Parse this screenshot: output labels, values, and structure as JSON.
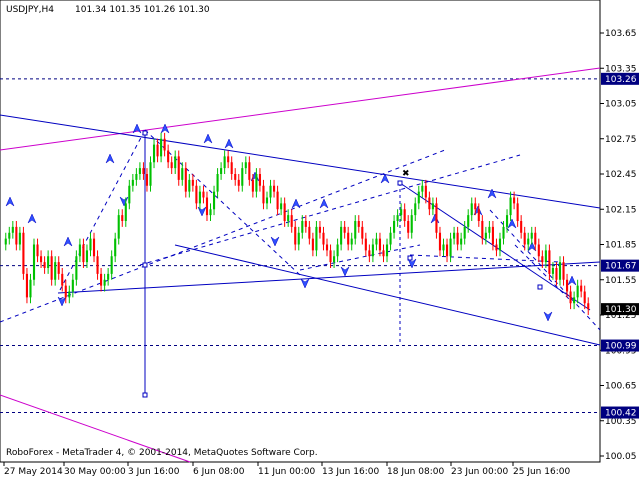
{
  "header": {
    "symbol": "USDJPY,H4",
    "ohlc": "101.34 101.35 101.26 101.30"
  },
  "footer": {
    "copyright": "RoboForex - MetaTrader 4, © 2001-2014, MetaQuotes Software Corp."
  },
  "chart_data": {
    "type": "candlestick",
    "title": "USDJPY,H4",
    "ylim": [
      99.975,
      103.775
    ],
    "y_ticks": [
      "103.65",
      "103.35",
      "103.05",
      "102.75",
      "102.45",
      "102.15",
      "101.85",
      "101.55",
      "101.25",
      "100.95",
      "100.65",
      "100.35",
      "100.05"
    ],
    "x_ticks": [
      "27 May 2014",
      "30 May 00:00",
      "3 Jun 16:00",
      "6 Jun 08:00",
      "11 Jun 00:00",
      "13 Jun 16:00",
      "18 Jun 08:00",
      "23 Jun 00:00",
      "25 Jun 16:00"
    ],
    "price_labels": [
      {
        "value": 103.26,
        "text": "103.26",
        "color": "#000080"
      },
      {
        "value": 101.67,
        "text": "101.67",
        "color": "#000080"
      },
      {
        "value": 101.3,
        "text": "101.30",
        "color": "#000000"
      },
      {
        "value": 100.99,
        "text": "100.99",
        "color": "#000080"
      },
      {
        "value": 100.42,
        "text": "100.42",
        "color": "#000080"
      }
    ],
    "horizontal_levels": [
      103.26,
      101.67,
      100.99,
      100.42
    ],
    "bull_color": "#00c000",
    "bear_color": "#ff0000",
    "trendline_color": "#0000c0",
    "channel_color": "#cc00cc",
    "closes": [
      101.9,
      101.95,
      102.0,
      101.85,
      101.95,
      101.6,
      101.4,
      101.55,
      101.85,
      101.75,
      101.7,
      101.65,
      101.75,
      101.55,
      101.7,
      101.6,
      101.5,
      101.4,
      101.45,
      101.55,
      101.75,
      101.85,
      101.7,
      101.8,
      101.9,
      101.75,
      101.6,
      101.5,
      101.55,
      101.6,
      101.75,
      101.9,
      102.1,
      102.05,
      102.2,
      102.35,
      102.4,
      102.45,
      102.5,
      102.45,
      102.35,
      102.55,
      102.7,
      102.6,
      102.75,
      102.65,
      102.55,
      102.5,
      102.6,
      102.4,
      102.5,
      102.3,
      102.4,
      102.35,
      102.2,
      102.3,
      102.25,
      102.1,
      102.15,
      102.3,
      102.45,
      102.5,
      102.6,
      102.55,
      102.45,
      102.4,
      102.35,
      102.5,
      102.55,
      102.4,
      102.3,
      102.45,
      102.35,
      102.2,
      102.25,
      102.35,
      102.3,
      102.15,
      102.2,
      102.05,
      102.1,
      102.0,
      101.85,
      101.95,
      102.05,
      102.0,
      101.9,
      101.8,
      102.0,
      101.95,
      101.85,
      101.8,
      101.7,
      101.75,
      101.85,
      102.0,
      101.95,
      101.85,
      101.9,
      102.05,
      102.0,
      101.9,
      101.8,
      101.75,
      101.85,
      101.9,
      101.8,
      101.75,
      101.85,
      101.95,
      102.05,
      102.1,
      102.15,
      102.05,
      101.95,
      102.1,
      102.2,
      102.3,
      102.35,
      102.25,
      102.15,
      102.2,
      101.95,
      101.8,
      101.85,
      101.75,
      101.9,
      101.95,
      101.85,
      101.9,
      102.0,
      102.1,
      102.2,
      102.15,
      102.05,
      101.9,
      101.95,
      102.0,
      101.85,
      101.8,
      101.9,
      102.0,
      102.1,
      102.25,
      102.2,
      102.05,
      101.95,
      101.85,
      101.9,
      101.95,
      101.85,
      101.75,
      101.7,
      101.8,
      101.6,
      101.65,
      101.55,
      101.7,
      101.55,
      101.45,
      101.35,
      101.4,
      101.5,
      101.45,
      101.35,
      101.3
    ]
  }
}
